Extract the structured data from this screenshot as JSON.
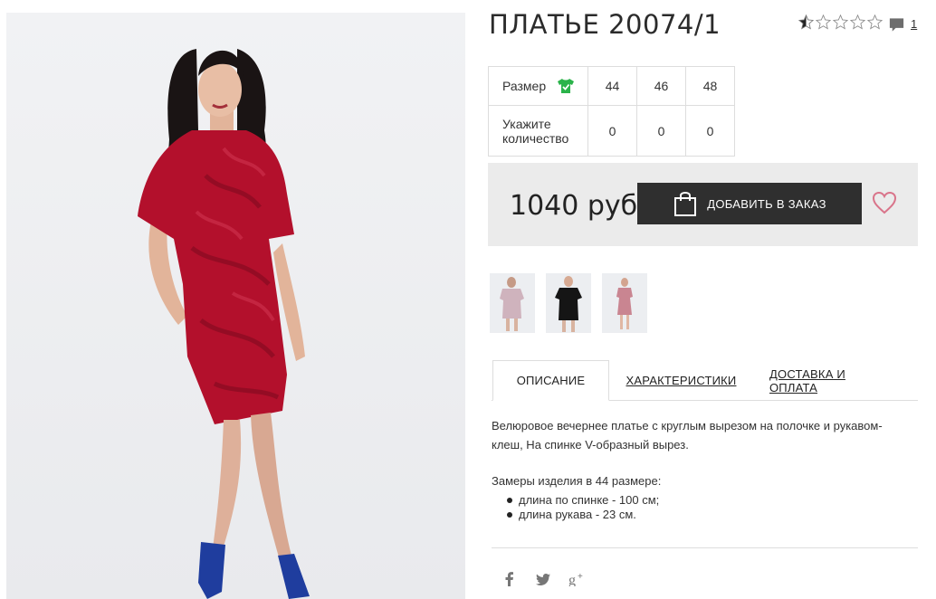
{
  "product": {
    "title": "ПЛАТЬЕ 20074/1",
    "rating": 0.5,
    "rating_max": 5,
    "comment_count": "1"
  },
  "size_table": {
    "size_label": "Размер",
    "qty_label": "Укажите количество",
    "sizes": [
      "44",
      "46",
      "48"
    ],
    "quantities": [
      "0",
      "0",
      "0"
    ]
  },
  "purchase": {
    "price": "1040 руб",
    "add_button": "ДОБАВИТЬ В ЗАКАЗ"
  },
  "tabs": [
    {
      "label": "ОПИСАНИЕ",
      "active": true
    },
    {
      "label": "ХАРАКТЕРИСТИКИ",
      "active": false
    },
    {
      "label": "ДОСТАВКА И ОПЛАТА",
      "active": false
    }
  ],
  "description": {
    "text": "Велюровое вечернее платье с круглым вырезом на полочке и рукавом-клеш, На спинке V-образный вырез.",
    "measure_title": "Замеры изделия в 44 размере:",
    "measures": [
      "длина по спинке - 100 см;",
      "длина рукава - 23 см."
    ]
  },
  "social": [
    "f",
    "twitter",
    "g+"
  ],
  "colors": {
    "dress_red": "#b3102c",
    "button_dark": "#2f2f2f",
    "heart_pink": "#d9748a",
    "shirt_green": "#2ab34a",
    "panel_grey": "#ebebeb"
  }
}
